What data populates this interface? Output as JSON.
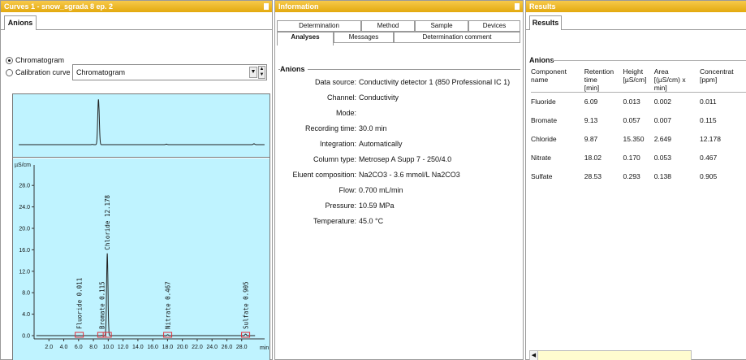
{
  "curves_panel": {
    "title": "Curves 1 - snow_sgrada 8 ep. 2",
    "tab": "Anions",
    "radio_options": [
      "Chromatogram",
      "Calibration curve"
    ],
    "selected_radio": "Chromatogram",
    "select_value": "Chromatogram",
    "y_unit": "µS/cm",
    "x_unit": "min",
    "y_ticks": [
      "28.0",
      "24.0",
      "20.0",
      "16.0",
      "12.0",
      "8.0",
      "4.0",
      "0.0"
    ],
    "x_ticks": [
      "2.0",
      "4.0",
      "6.0",
      "8.0",
      "10.0",
      "12.0",
      "14.0",
      "16.0",
      "18.0",
      "20.0",
      "22.0",
      "24.0",
      "26.0",
      "28.0"
    ],
    "peaks": [
      {
        "label": "Fluoride 0.011",
        "rt": 6.09,
        "height": 0.013
      },
      {
        "label": "Bromate 0.115",
        "rt": 9.13,
        "height": 0.057
      },
      {
        "label": "Chloride 12.178",
        "rt": 9.87,
        "height": 15.35
      },
      {
        "label": "Nitrate 0.467",
        "rt": 18.02,
        "height": 0.17
      },
      {
        "label": "Sulfate 0.905",
        "rt": 28.53,
        "height": 0.293
      }
    ],
    "plot_colors": {
      "background": "#bff3ff",
      "trace": "#222222",
      "markers": "#e0303a"
    }
  },
  "info_panel": {
    "title": "Information",
    "tabs_row1": [
      "Determination",
      "Method",
      "Sample",
      "Devices"
    ],
    "tabs_row2": [
      "Analyses",
      "Messages",
      "Determination comment"
    ],
    "active_tab": "Analyses",
    "section": "Anions",
    "rows": [
      {
        "k": "Data source:",
        "v": "Conductivity detector 1 (850 Professional IC 1)"
      },
      {
        "k": "Channel:",
        "v": "Conductivity"
      },
      {
        "k": "Mode:",
        "v": ""
      },
      {
        "k": "Recording time:",
        "v": "30.0 min"
      },
      {
        "k": "Integration:",
        "v": "Automatically"
      },
      {
        "k": "Column type:",
        "v": "Metrosep A Supp 7 - 250/4.0"
      },
      {
        "k": "Eluent composition:",
        "v": "Na2CO3 - 3.6 mmol/L Na2CO3"
      },
      {
        "k": "Flow:",
        "v": "0.700 mL/min"
      },
      {
        "k": "Pressure:",
        "v": "10.59 MPa"
      },
      {
        "k": "Temperature:",
        "v": "45.0 °C"
      }
    ]
  },
  "results_panel": {
    "title": "Results",
    "tab": "Results",
    "section": "Anions",
    "columns": [
      {
        "l1": "Component name",
        "l2": ""
      },
      {
        "l1": "Retention time",
        "l2": "[min]"
      },
      {
        "l1": "Height",
        "l2": "[µS/cm]"
      },
      {
        "l1": "Area",
        "l2": "[(µS/cm) x min]"
      },
      {
        "l1": "Concentrat",
        "l2": "[ppm]"
      }
    ],
    "rows": [
      [
        "Fluoride",
        "6.09",
        "0.013",
        "0.002",
        "0.011"
      ],
      [
        "Bromate",
        "9.13",
        "0.057",
        "0.007",
        "0.115"
      ],
      [
        "Chloride",
        "9.87",
        "15.350",
        "2.649",
        "12.178"
      ],
      [
        "Nitrate",
        "18.02",
        "0.170",
        "0.053",
        "0.467"
      ],
      [
        "Sulfate",
        "28.53",
        "0.293",
        "0.138",
        "0.905"
      ]
    ]
  }
}
